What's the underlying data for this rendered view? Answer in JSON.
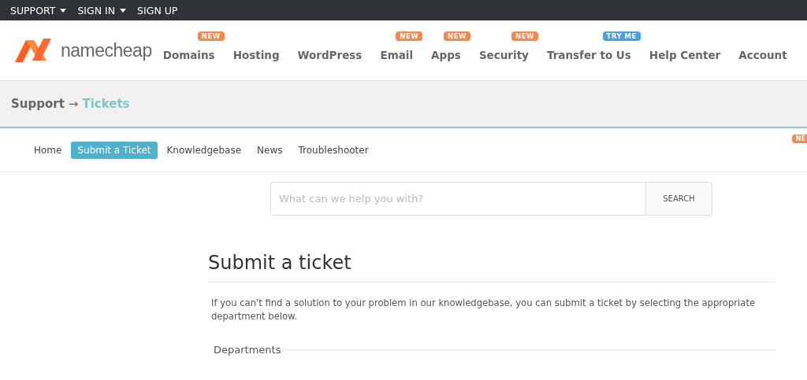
{
  "top_bar": {
    "items": [
      {
        "label": "SUPPORT",
        "dropdown": true
      },
      {
        "label": "SIGN IN",
        "dropdown": true
      },
      {
        "label": "SIGN UP",
        "dropdown": false
      }
    ]
  },
  "header": {
    "logo_text": "namecheap",
    "nav": [
      {
        "label": "Domains",
        "badge": {
          "text": "NEW",
          "color": "#f5874f"
        }
      },
      {
        "label": "Hosting"
      },
      {
        "label": "WordPress"
      },
      {
        "label": "Email",
        "badge": {
          "text": "NEW",
          "color": "#f5874f"
        }
      },
      {
        "label": "Apps",
        "badge": {
          "text": "NEW",
          "color": "#f5874f"
        }
      },
      {
        "label": "Security",
        "badge": {
          "text": "NEW",
          "color": "#f5874f"
        }
      },
      {
        "label": "Transfer to Us",
        "badge": {
          "text": "TRY ME",
          "color": "#4a9fe0"
        }
      },
      {
        "label": "Help Center"
      },
      {
        "label": "Account"
      }
    ]
  },
  "breadcrumb": {
    "parent": "Support",
    "separator": "→",
    "current": "Tickets"
  },
  "subnav": {
    "items": [
      {
        "label": "Home",
        "selected": false
      },
      {
        "label": "Submit a Ticket",
        "selected": true
      },
      {
        "label": "Knowledgebase",
        "selected": false
      },
      {
        "label": "News",
        "selected": false
      },
      {
        "label": "Troubleshooter",
        "selected": false
      }
    ],
    "edge_badge": "NE"
  },
  "search": {
    "placeholder": "What can we help you with?",
    "button": "SEARCH"
  },
  "content": {
    "title": "Submit a ticket",
    "description": "If you can't find a solution to your problem in our knowledgebase, you can submit a ticket by selecting the appropriate department below.",
    "section": "Departments"
  }
}
